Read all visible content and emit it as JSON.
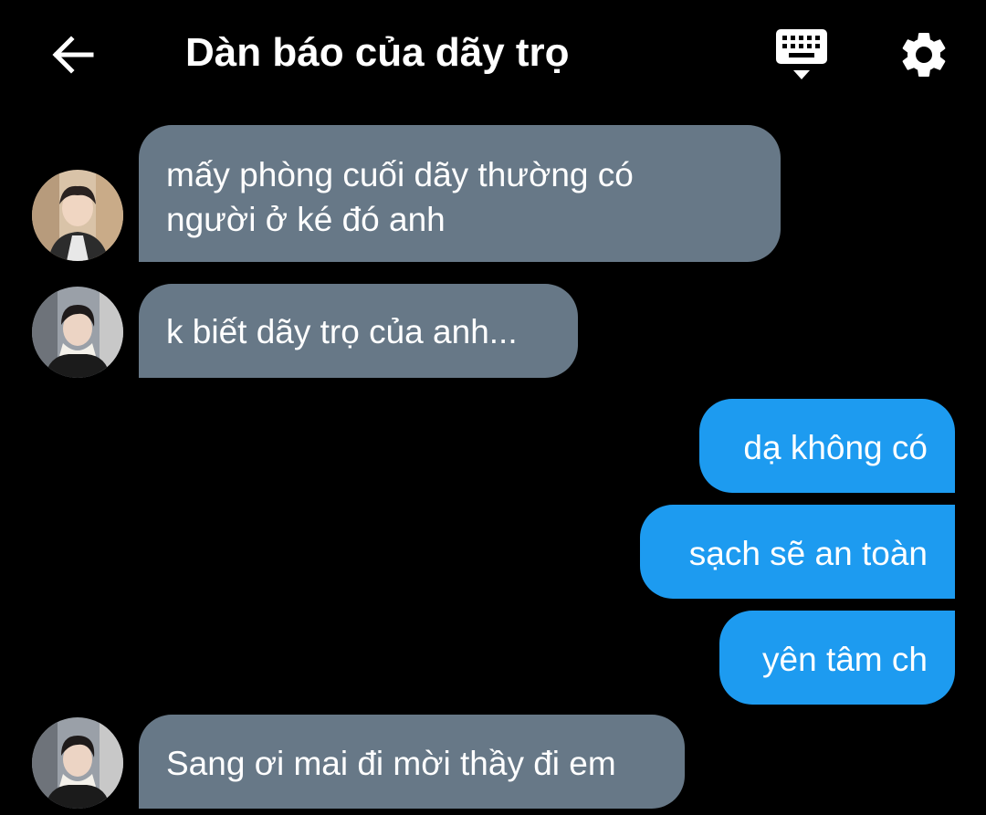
{
  "header": {
    "title": "Dàn báo của dãy trọ",
    "back_icon": "arrow-left-icon",
    "keyboard_icon": "keyboard-hide-icon",
    "settings_icon": "gear-icon"
  },
  "colors": {
    "background": "#000000",
    "incoming_bubble": "#677887",
    "outgoing_bubble": "#1d9bf0",
    "text": "#ffffff"
  },
  "messages": [
    {
      "side": "incoming",
      "avatar": "avatar-1",
      "lines": [
        "mấy phòng cuối dãy thường có",
        "người ở ké đó anh"
      ]
    },
    {
      "side": "incoming",
      "avatar": "avatar-2",
      "lines": [
        "k biết dãy trọ của anh..."
      ]
    },
    {
      "side": "outgoing",
      "lines": [
        "dạ không có"
      ]
    },
    {
      "side": "outgoing",
      "lines": [
        "sạch sẽ an toàn"
      ]
    },
    {
      "side": "outgoing",
      "lines": [
        "yên tâm ch"
      ]
    },
    {
      "side": "incoming",
      "avatar": "avatar-2",
      "lines": [
        "Sang ơi mai đi mời thầy đi em"
      ]
    }
  ]
}
